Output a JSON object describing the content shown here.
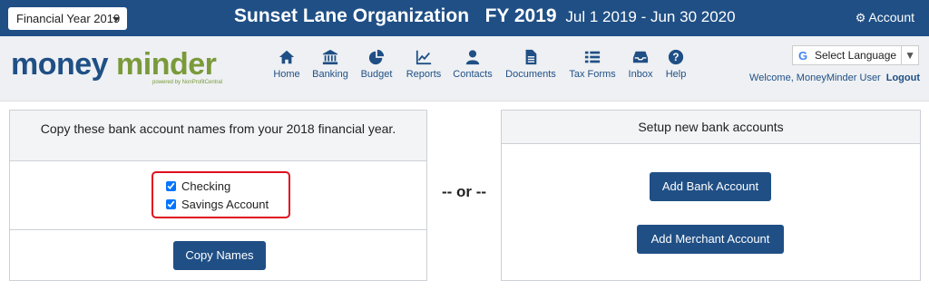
{
  "topbar": {
    "fy_selector": "Financial Year 2019",
    "org_name": "Sunset Lane Organization",
    "fy_label": "FY 2019",
    "date_range": "Jul 1 2019 - Jun 30 2020",
    "account_label": "Account"
  },
  "logo": {
    "part1": "money",
    "part2": "minder",
    "tagline": "powered by NonProfitCentral"
  },
  "nav": {
    "home": "Home",
    "banking": "Banking",
    "budget": "Budget",
    "reports": "Reports",
    "contacts": "Contacts",
    "documents": "Documents",
    "tax_forms": "Tax Forms",
    "inbox": "Inbox",
    "help": "Help"
  },
  "language": {
    "label": "Select Language",
    "g": "G",
    "arrow": "▼"
  },
  "user": {
    "welcome": "Welcome, MoneyMinder User",
    "logout": "Logout"
  },
  "left_panel": {
    "heading": "Copy these bank account names from your 2018 financial year.",
    "accounts": [
      {
        "label": "Checking",
        "checked": true
      },
      {
        "label": "Savings Account",
        "checked": true
      }
    ],
    "copy_button": "Copy Names"
  },
  "or_text": "-- or --",
  "right_panel": {
    "heading": "Setup new bank accounts",
    "add_bank_button": "Add Bank Account",
    "add_merchant_button": "Add Merchant Account"
  },
  "colors": {
    "brand_blue": "#1f4f85",
    "brand_green": "#7a9a3a",
    "highlight_red": "#e0101e"
  }
}
